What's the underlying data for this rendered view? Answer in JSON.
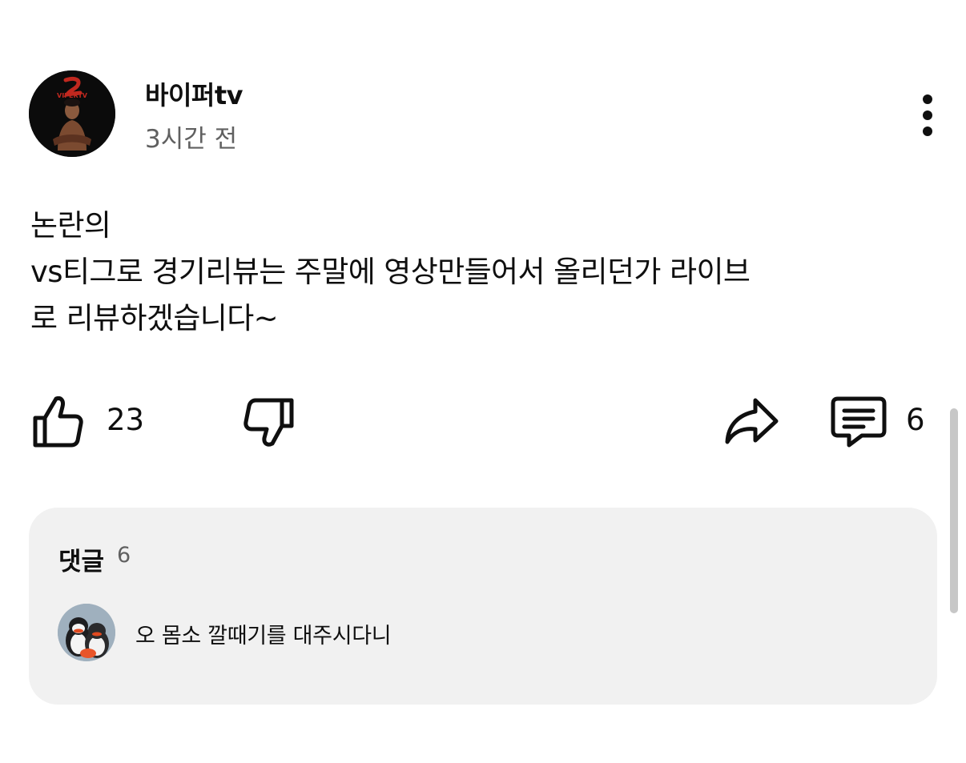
{
  "post": {
    "channel_name": "바이퍼tv",
    "time": "3시간 전",
    "body_lines": [
      "논란의",
      "vs티그로 경기리뷰는 주말에 영상만들어서 올리던가 라이브",
      "로 리뷰하겠습니다~"
    ],
    "avatar_text": "VIPERTV"
  },
  "actions": {
    "like_count": "23",
    "comment_count": "6",
    "icons": [
      "thumbs-up-icon",
      "thumbs-down-icon",
      "share-icon",
      "comment-icon",
      "more-vert-icon"
    ]
  },
  "comments": {
    "heading": "댓글",
    "count": "6",
    "top_comment": {
      "text": "오 몸소 깔때기를 대주시다니"
    }
  },
  "colors": {
    "text": "#0f0f0f",
    "secondary": "#606060",
    "panel": "#f1f1f1"
  }
}
